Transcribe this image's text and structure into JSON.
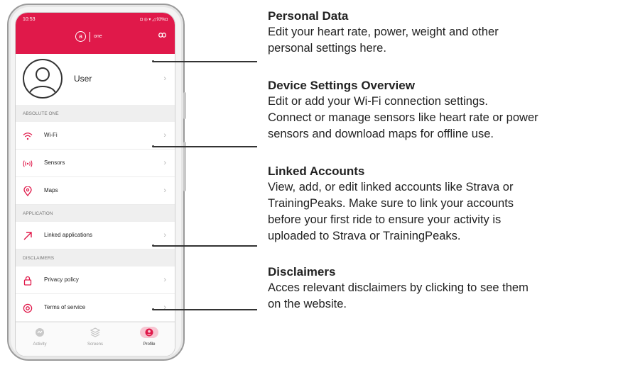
{
  "status": {
    "time": "10:53",
    "icons": "◘ ◎ ▾ ◿ 93%◘"
  },
  "header": {
    "brand_mark": "a",
    "brand_text": "one"
  },
  "user": {
    "name": "User"
  },
  "sections": {
    "absolute_one": "ABSOLUTE ONE",
    "application": "APPLICATION",
    "disclaimers": "DISCLAIMERS"
  },
  "menu": {
    "wifi": "Wi-Fi",
    "sensors": "Sensors",
    "maps": "Maps",
    "linked_apps": "Linked applications",
    "privacy": "Privacy policy",
    "terms": "Terms of service"
  },
  "chevron": "›",
  "nav": {
    "activity": "Activity",
    "screens": "Screens",
    "profile": "Profile"
  },
  "notes": [
    {
      "title": "Personal Data",
      "lines": [
        "Edit your heart rate, power, weight and other",
        "personal settings here."
      ]
    },
    {
      "title": "Device Settings Overview",
      "lines": [
        "Edit or add your Wi-Fi connection settings.",
        "Connect or manage sensors like heart rate or power",
        "sensors and download maps for offline use."
      ]
    },
    {
      "title": "Linked Accounts",
      "lines": [
        "View, add, or edit linked accounts like Strava or",
        "TrainingPeaks. Make sure to link your accounts",
        "before your first ride to ensure your activity is",
        "uploaded to Strava or TrainingPeaks."
      ]
    },
    {
      "title": "Disclaimers",
      "lines": [
        "Acces relevant disclaimers by clicking to see them",
        "on the website."
      ]
    }
  ],
  "colors": {
    "accent": "#e0194a"
  }
}
